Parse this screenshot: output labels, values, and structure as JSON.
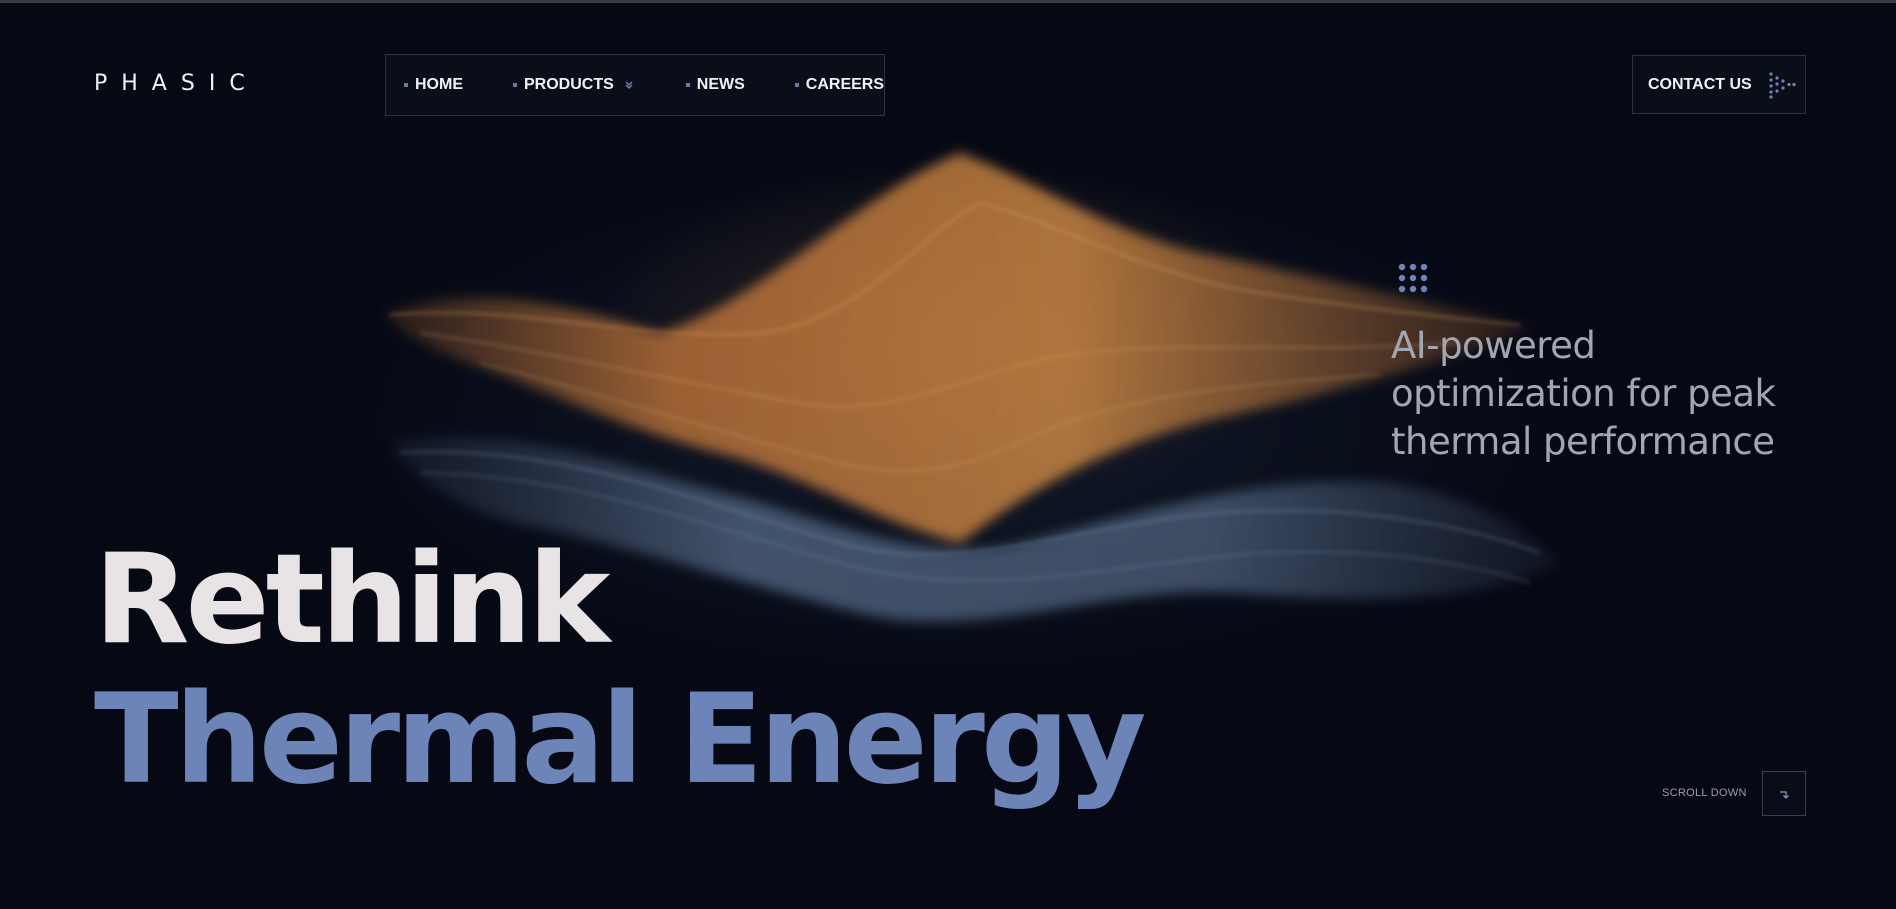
{
  "brand": {
    "logo_text": "PHASIC"
  },
  "nav": {
    "items": [
      {
        "label": "HOME"
      },
      {
        "label": "PRODUCTS",
        "has_dropdown": true
      },
      {
        "label": "NEWS"
      },
      {
        "label": "CAREERS"
      }
    ]
  },
  "contact": {
    "label": "CONTACT US",
    "icon": "arrow-dots-icon"
  },
  "hero": {
    "tagline_line1": "AI-powered",
    "tagline_line2": "optimization for peak",
    "tagline_line3": "thermal performance",
    "headline_line1": "Rethink",
    "headline_line2": "Thermal Energy",
    "grid_icon": "dots-grid-icon"
  },
  "scroll": {
    "label": "SCROLL DOWN",
    "icon": "arrow-down-right-icon"
  },
  "colors": {
    "background": "#060914",
    "accent_blue": "#6d84b8",
    "headline_light": "#e8e4e6",
    "wave_orange": "#c7793a",
    "wave_blue": "#5e7596",
    "border": "#2d3140"
  }
}
